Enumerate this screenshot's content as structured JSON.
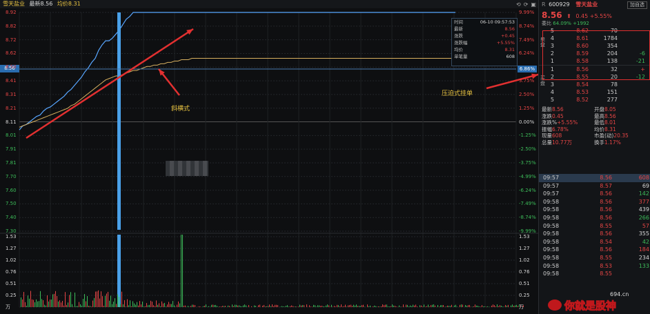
{
  "header": {
    "stock_name_short": "雪天盐业",
    "latest_label": "最新8.56",
    "avg_label": "均价8.31"
  },
  "toolbar_icons": [
    "rotate-icon",
    "refresh-icon",
    "layout-icon"
  ],
  "price_axis_left": [
    "8.92",
    "8.82",
    "8.72",
    "8.62",
    "8.50",
    "8.41",
    "8.31",
    "8.21",
    "8.11",
    "8.01",
    "7.91",
    "7.81",
    "7.70",
    "7.60",
    "7.50",
    "7.40",
    "7.30"
  ],
  "price_axis_right": [
    "9.99%",
    "8.74%",
    "7.49%",
    "6.24%",
    "",
    "3.75%",
    "2.50%",
    "1.25%",
    "0.00%",
    "-1.25%",
    "-2.50%",
    "-3.75%",
    "-4.99%",
    "-6.24%",
    "-7.49%",
    "-8.74%",
    "-9.99%"
  ],
  "current_left": "8.56",
  "current_right": "6.86%",
  "volume_axis": [
    "1.53",
    "1.27",
    "1.02",
    "0.76",
    "0.51",
    "0.25",
    "万"
  ],
  "tooltip": [
    {
      "k": "时间",
      "v": "06-10 09:57:53",
      "c": "wht"
    },
    {
      "k": "最新",
      "v": "8.56",
      "c": "red"
    },
    {
      "k": "涨跌",
      "v": "+0.45",
      "c": "red"
    },
    {
      "k": "涨跌幅",
      "v": "+5.55%",
      "c": "red"
    },
    {
      "k": "均价",
      "v": "8.31",
      "c": "red"
    },
    {
      "k": "单笔量",
      "v": "608",
      "c": "wht"
    }
  ],
  "annotations": {
    "slope": "斜横式",
    "pressure": "压迫式挂单"
  },
  "chart_data": {
    "type": "line",
    "ylim": [
      7.3,
      8.92
    ],
    "prev_close": 8.11,
    "series": [],
    "x": [
      0,
      5,
      10,
      15,
      20,
      25,
      30,
      35,
      40,
      45,
      50,
      55,
      60,
      65,
      70,
      75,
      80,
      85,
      90,
      95,
      100,
      105,
      110,
      115,
      120,
      125,
      130,
      135,
      140,
      145,
      150,
      155,
      160,
      165,
      170,
      175,
      180,
      185,
      190,
      195,
      200,
      205,
      210,
      215,
      220,
      225,
      230,
      235,
      240,
      245,
      250,
      255,
      260
    ],
    "price": [
      8.05,
      8.08,
      8.09,
      8.11,
      8.13,
      8.15,
      8.16,
      8.19,
      8.21,
      8.22,
      8.24,
      8.26,
      8.28,
      8.3,
      8.33,
      8.35,
      8.38,
      8.41,
      8.44,
      8.48,
      8.51,
      8.55,
      8.58,
      8.64,
      8.68,
      8.71,
      8.71,
      8.73,
      8.76,
      8.79,
      8.83,
      8.87,
      8.89,
      8.92,
      8.95,
      8.98,
      9.0,
      9.02,
      9.05,
      9.06,
      9.08,
      9.1,
      9.12,
      9.14,
      9.16,
      9.18,
      9.2,
      9.22,
      9.24,
      9.26,
      9.28,
      9.3,
      9.32
    ],
    "avg": [
      8.07,
      8.08,
      8.09,
      8.1,
      8.11,
      8.12,
      8.13,
      8.14,
      8.15,
      8.16,
      8.17,
      8.18,
      8.19,
      8.2,
      8.21,
      8.23,
      8.24,
      8.26,
      8.28,
      8.3,
      8.32,
      8.34,
      8.36,
      8.38,
      8.4,
      8.42,
      8.43,
      8.44,
      8.45,
      8.45,
      8.46,
      8.47,
      8.48,
      8.49,
      8.49,
      8.5,
      8.51,
      8.52,
      8.52,
      8.53,
      8.53,
      8.54,
      8.54,
      8.55,
      8.55,
      8.56,
      8.56,
      8.57,
      8.57,
      8.57,
      8.58,
      8.58,
      8.58
    ]
  },
  "panel": {
    "code": "600929",
    "name": "雪天盐业",
    "button": "加自选",
    "price": "8.56",
    "change": "0.45 +5.55%",
    "webi_label": "委比",
    "webi": "64.09%",
    "weicha": "+1992",
    "sell_label": "卖盘",
    "buy_label": "买盘",
    "sells": [
      {
        "i": "5",
        "p": "8.62",
        "v": "70",
        "d": ""
      },
      {
        "i": "4",
        "p": "8.61",
        "v": "1784",
        "d": ""
      },
      {
        "i": "3",
        "p": "8.60",
        "v": "354",
        "d": ""
      },
      {
        "i": "2",
        "p": "8.59",
        "v": "204",
        "d": "-6"
      },
      {
        "i": "1",
        "p": "8.58",
        "v": "138",
        "d": "-21"
      }
    ],
    "buys": [
      {
        "i": "1",
        "p": "8.56",
        "v": "32",
        "d": "+"
      },
      {
        "i": "2",
        "p": "8.55",
        "v": "20",
        "d": "-12"
      },
      {
        "i": "3",
        "p": "8.54",
        "v": "78",
        "d": ""
      },
      {
        "i": "4",
        "p": "8.53",
        "v": "151",
        "d": ""
      },
      {
        "i": "5",
        "p": "8.52",
        "v": "277",
        "d": ""
      }
    ],
    "stats": [
      [
        "最新",
        "8.56",
        "开盘",
        "8.05"
      ],
      [
        "涨跌",
        "0.45",
        "最高",
        "8.56"
      ],
      [
        "涨跌%",
        "+5.55%",
        "最低",
        "8.01"
      ],
      [
        "振幅",
        "6.78%",
        "均价",
        "8.31"
      ],
      [
        "现量",
        "608",
        "市盈(动)",
        "20.35"
      ],
      [
        "总量",
        "10.77万",
        "换手",
        "1.17%"
      ]
    ],
    "ticks": [
      {
        "t": "09:57",
        "p": "8.56",
        "v": "608",
        "s": true
      },
      {
        "t": "09:57",
        "p": "8.57",
        "v": "69",
        "s": false
      },
      {
        "t": "09:57",
        "p": "8.56",
        "v": "142",
        "s": false
      },
      {
        "t": "09:58",
        "p": "8.56",
        "v": "377",
        "s": false
      },
      {
        "t": "09:58",
        "p": "8.56",
        "v": "439",
        "s": false
      },
      {
        "t": "09:58",
        "p": "8.56",
        "v": "266",
        "s": false
      },
      {
        "t": "09:58",
        "p": "8.55",
        "v": "57",
        "s": false
      },
      {
        "t": "09:58",
        "p": "8.56",
        "v": "355",
        "s": false
      },
      {
        "t": "09:58",
        "p": "8.54",
        "v": "42",
        "s": false
      },
      {
        "t": "09:58",
        "p": "8.56",
        "v": "184",
        "s": false
      },
      {
        "t": "09:58",
        "p": "8.55",
        "v": "234",
        "s": false
      },
      {
        "t": "09:58",
        "p": "8.53",
        "v": "133",
        "s": false
      },
      {
        "t": "09:58",
        "p": "8.55",
        "v": "",
        "s": false
      }
    ]
  },
  "watermark": {
    "text": "你就是股神",
    "site": "694.cn"
  }
}
